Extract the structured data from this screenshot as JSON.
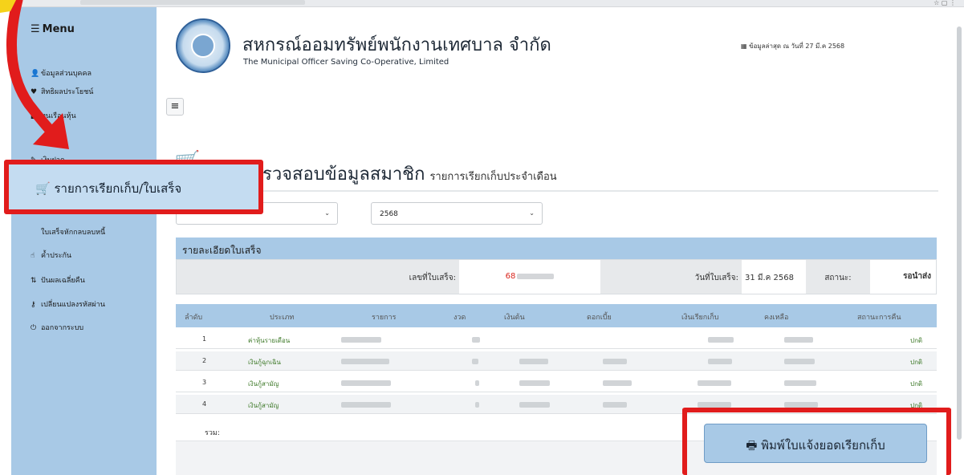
{
  "browser": {
    "icons": "☆ ▢ ⋮"
  },
  "sidebar": {
    "menu_title": "Menu",
    "items": [
      {
        "label": "ข้อมูลส่วนบุคคล",
        "icon": "user-icon",
        "glyph": "👤"
      },
      {
        "label": "สิทธิผลประโยชน์",
        "icon": "heart-icon",
        "glyph": "♥"
      },
      {
        "label": "ทุนเรือนหุ้น",
        "icon": "chart-icon",
        "glyph": "▮"
      },
      {
        "label": "เงินฝาก",
        "icon": "wrench-icon",
        "glyph": "✎"
      },
      {
        "label": "ใบเสร็จหักกลบลบหนี้",
        "icon": "",
        "glyph": ""
      },
      {
        "label": "ค้ำประกัน",
        "icon": "thumb-icon",
        "glyph": "☝"
      },
      {
        "label": "ปันผลเฉลี่ยคืน",
        "icon": "sort-icon",
        "glyph": "⇅"
      },
      {
        "label": "เปลี่ยนแปลงรหัสผ่าน",
        "icon": "key-icon",
        "glyph": "⚷"
      },
      {
        "label": "ออกจากระบบ",
        "icon": "power-icon",
        "glyph": "⏻"
      }
    ],
    "highlighted_item": {
      "label": "รายการเรียกเก็บ/ใบเสร็จ",
      "icon": "cart-icon",
      "glyph": "🛒"
    }
  },
  "header": {
    "org_name_th": "สหกรณ์ออมทรัพย์พนักงานเทศบาล จำกัด",
    "org_name_en": "The Municipal Officer Saving Co-Operative, Limited",
    "last_update": "ข้อมูลล่าสุด ณ วันที่ 27 มี.ค 2568",
    "last_update_icon": "calendar-icon"
  },
  "page": {
    "title_main": "รวจสอบข้อมูลสมาชิก",
    "title_sub": "รายการเรียกเก็บประจำเดือน",
    "month_select": "",
    "year_select": "2568"
  },
  "receipt": {
    "panel_title": "รายละเอียดใบเสร็จ",
    "receipt_no_label": "เลขที่ใบเสร็จ:",
    "receipt_no_value": "68",
    "date_label": "วันที่ใบเสร็จ:",
    "date_value": "31 มี.ค 2568",
    "status_label": "สถานะ:",
    "status_value": "รอนำส่ง",
    "status_color": "#d9251d"
  },
  "table": {
    "headers": [
      "ลำดับ",
      "ประเภท",
      "รายการ",
      "งวด",
      "เงินต้น",
      "ดอกเบี้ย",
      "เงินเรียกเก็บ",
      "คงเหลือ",
      "สถานะการคืน"
    ],
    "rows": [
      {
        "no": "1",
        "type": "ค่าหุ้นรายเดือน",
        "status": "ปกติ"
      },
      {
        "no": "2",
        "type": "เงินกู้ฉุกเฉิน",
        "status": "ปกติ"
      },
      {
        "no": "3",
        "type": "เงินกู้สามัญ",
        "status": "ปกติ"
      },
      {
        "no": "4",
        "type": "เงินกู้สามัญ",
        "status": "ปกติ"
      }
    ],
    "total_label": "รวม:"
  },
  "actions": {
    "print_label": "พิมพ์ใบแจ้งยอดเรียกเก็บ",
    "print_icon": "printer-icon"
  },
  "colors": {
    "sidebar_bg": "#a8c9e6",
    "highlight_red": "#e11c1c",
    "status_green": "#3f7a2a"
  }
}
